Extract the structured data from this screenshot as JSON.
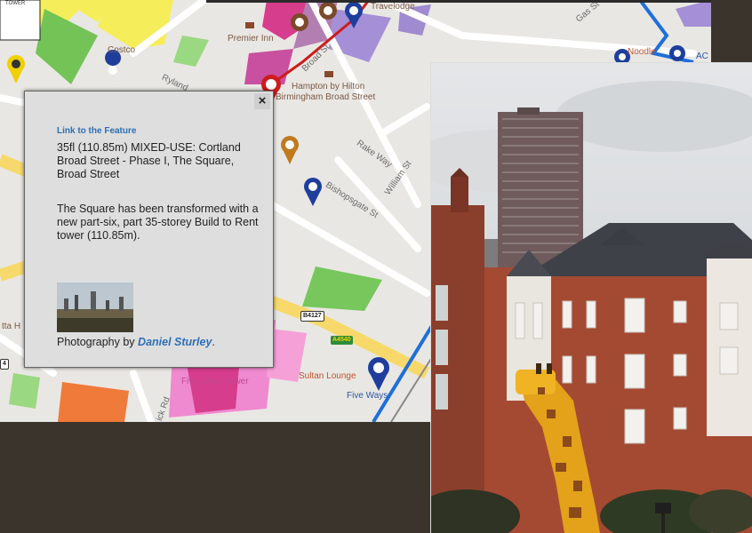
{
  "map": {
    "labels": {
      "costco": "Costco",
      "premier_inn": "Premier Inn",
      "travelodge": "Travelodge",
      "hampton": "Hampton by Hilton",
      "hampton2": "Birmingham Broad Street",
      "broad_st": "Broad St",
      "gas_st": "Gas St",
      "ryland": "Ryland",
      "rake_way": "Rake Way",
      "william_st": "William St",
      "bishopsgate": "Bishopsgate St",
      "sultan": "Sultan Lounge",
      "five_ways_tower": "Five Ways Tower",
      "five_ways": "Five Ways",
      "ick_rd": "ick Rd",
      "corner_tl": "TOWER",
      "ac": "AC H",
      "noodle": "Noodle",
      "etta": "tta H"
    },
    "shields": {
      "b4127": "B4127",
      "a4540": "A4540",
      "four": "4"
    },
    "colors": {
      "residential": "#f5ee5a",
      "commercial": "#d63d8c",
      "park": "#7fc65a",
      "purple": "#a58fd6",
      "primary_road": "#f7d96b",
      "rail": "#1e6fd9",
      "marker_blue": "#1f3e9c",
      "marker_red": "#d01b1b",
      "marker_orange": "#c07a1d",
      "marker_yellow": "#f0d000"
    }
  },
  "popup": {
    "close_label": "×",
    "link_label": "Link to the Feature",
    "title": "35fl (110.85m) MIXED-USE: Cortland Broad Street - Phase I, The Square, Broad Street",
    "description": "The Square has been transformed with a new part-six, part 35-storey Build to Rent tower (110.85m).",
    "credit_prefix": "Photography by ",
    "credit_name": "Daniel Sturley",
    "credit_suffix": "."
  }
}
